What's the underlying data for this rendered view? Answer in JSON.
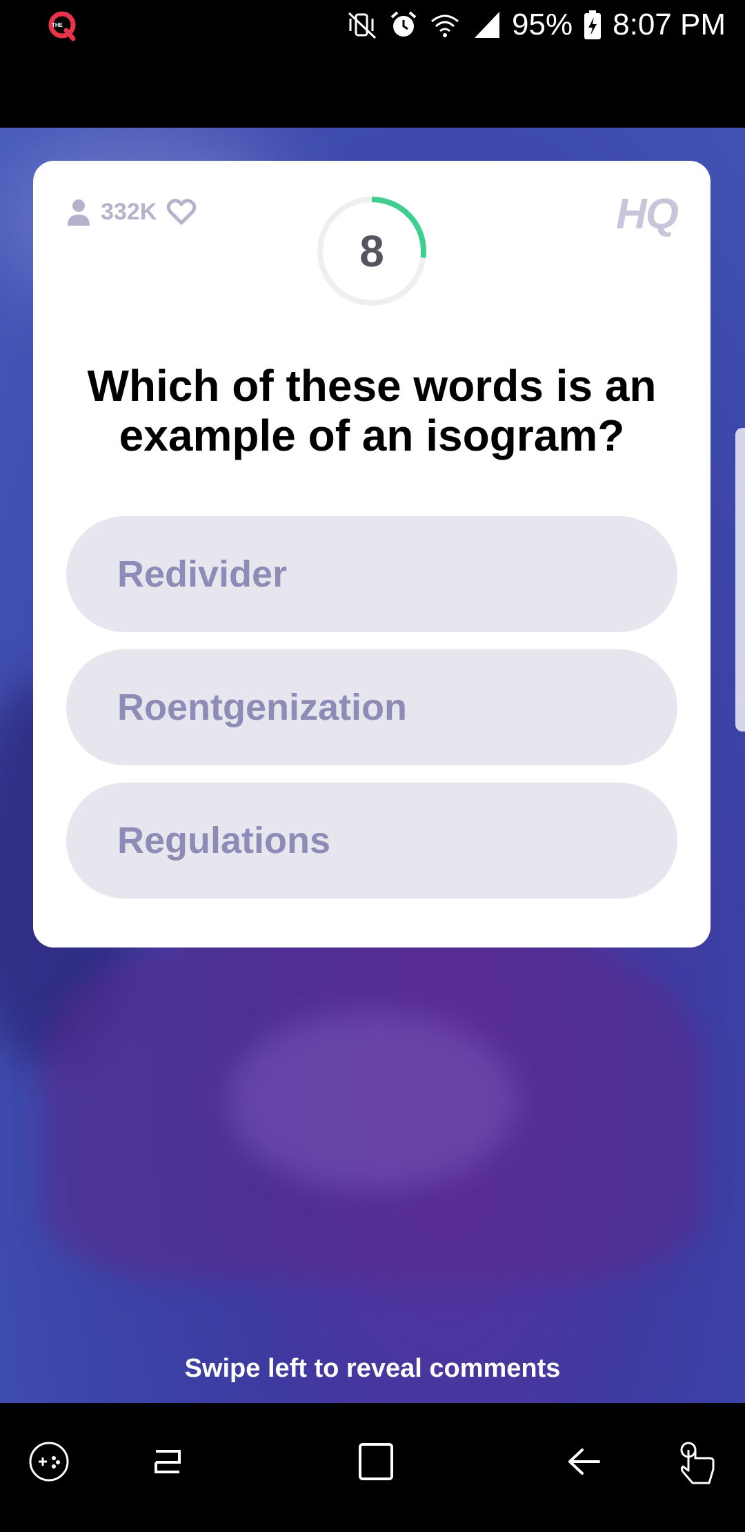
{
  "status_bar": {
    "app_icon": "hq-q-logo",
    "icons": [
      "mute-vibrate-icon",
      "alarm-icon",
      "wifi-icon",
      "signal-icon",
      "battery-charging-icon"
    ],
    "battery": "95%",
    "time": "8:07 PM"
  },
  "game": {
    "viewers": "332K",
    "brand": "HQ",
    "timer": "8",
    "timer_progress": 0.27,
    "question": "Which of these words is an example of an isogram?",
    "answers": [
      "Redivider",
      "Roentgenization",
      "Regulations"
    ],
    "hint": "Swipe left to reveal comments"
  },
  "nav_bar": {
    "icons": [
      "game-tools-icon",
      "recents-icon",
      "home-icon",
      "back-icon",
      "gesture-icon"
    ]
  },
  "colors": {
    "accent_green": "#3ecf8e",
    "answer_bg": "#e7e6ee",
    "answer_text": "#8d8cb6"
  }
}
